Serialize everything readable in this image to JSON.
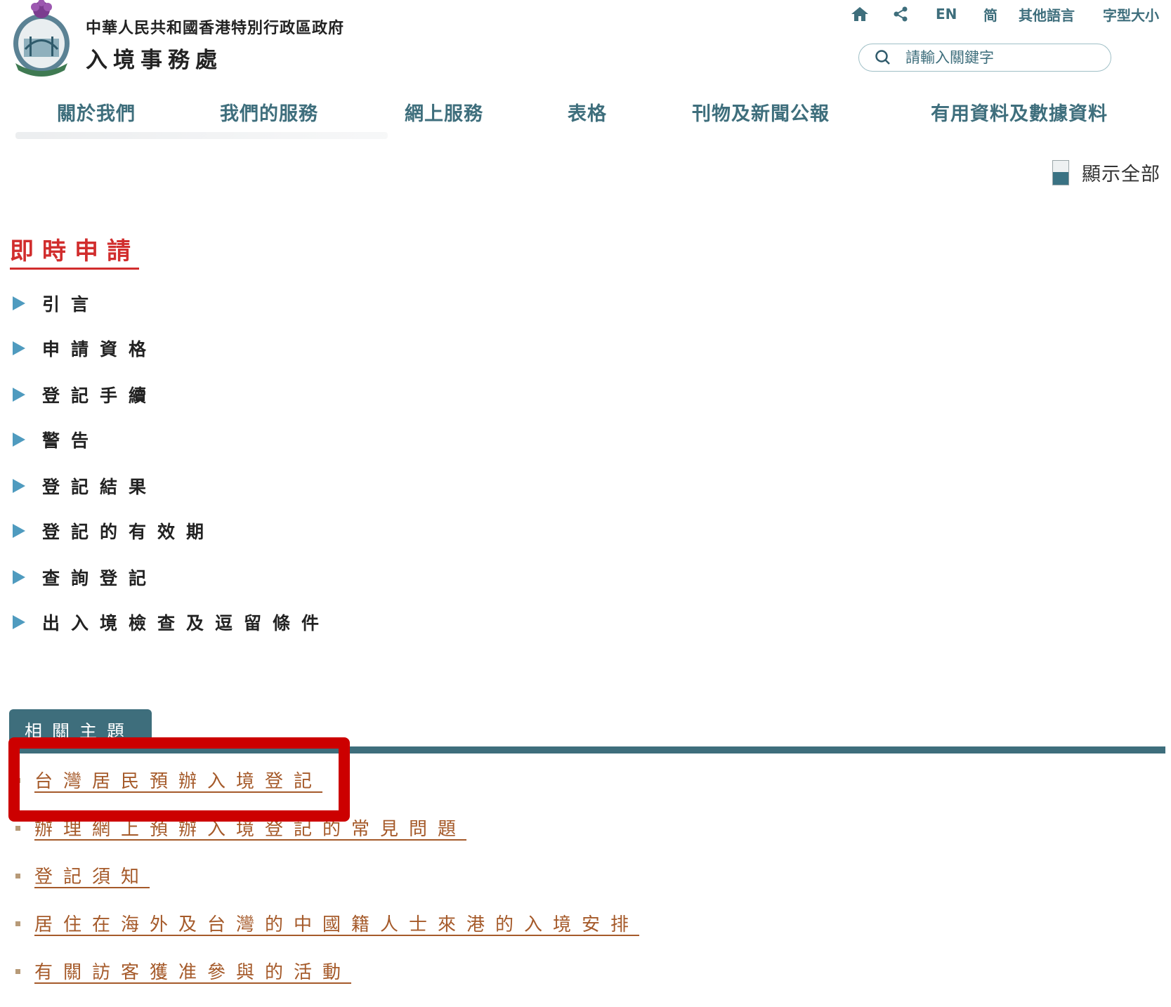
{
  "header": {
    "gov_title": "中華人民共和國香港特別行政區政府",
    "dept_title": "入境事務處"
  },
  "utility": {
    "en": "EN",
    "simplified": "简",
    "other_languages": "其他語言",
    "font_size": "字型大小"
  },
  "search": {
    "placeholder": "請輸入關鍵字"
  },
  "nav": {
    "items": [
      "關於我們",
      "我們的服務",
      "網上服務",
      "表格",
      "刊物及新聞公報",
      "有用資料及數據資料"
    ]
  },
  "show_all": "顯示全部",
  "section_title": "即時申請",
  "accordion": [
    "引言",
    "申請資格",
    "登記手續",
    "警告",
    "登記結果",
    "登記的有效期",
    "查詢登記",
    "出入境檢查及逗留條件"
  ],
  "related": {
    "tab_label": "相關主題",
    "links": [
      "台灣居民預辦入境登記",
      "辦理網上預辦入境登記的常見問題",
      "登記須知",
      "居住在海外及台灣的中國籍人士來港的入境安排",
      "有關訪客獲准參與的活動"
    ]
  },
  "colors": {
    "brand_teal": "#3e6e7c",
    "heading_red": "#d12d2d",
    "link_brown": "#a55a2a",
    "highlight_red": "#cc0000"
  }
}
